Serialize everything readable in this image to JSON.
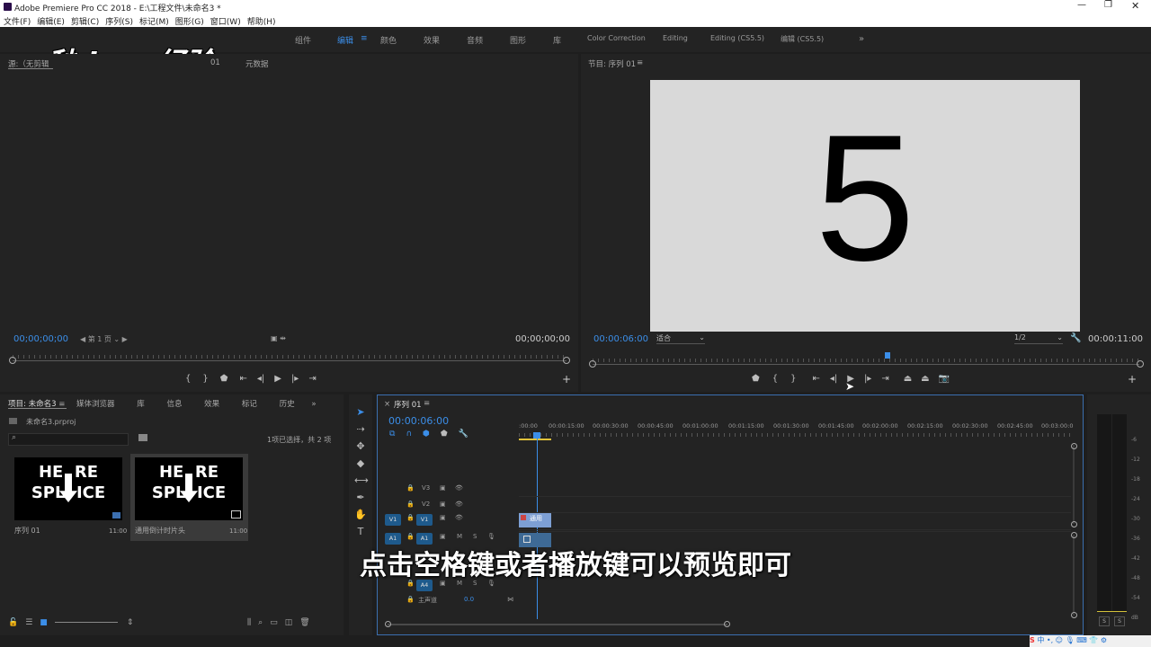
{
  "window": {
    "title": "Adobe Premiere Pro CC 2018 - E:\\工程文件\\未命名3 *"
  },
  "menu": [
    "文件(F)",
    "编辑(E)",
    "剪辑(C)",
    "序列(S)",
    "标记(M)",
    "图形(G)",
    "窗口(W)",
    "帮助(H)"
  ],
  "workspaces": [
    "组件",
    "编辑",
    "颜色",
    "效果",
    "音频",
    "图形",
    "库",
    "Color Correction",
    "Editing",
    "Editing (CS5.5)",
    "编辑 (CS5.5)"
  ],
  "watermark": "秒dong经验",
  "source": {
    "tab": "源:（无剪辑",
    "tab_suffix": "01",
    "meta_tab": "元数据",
    "tc_left": "00;00;00;00",
    "page": "第 1 页",
    "tc_right": "00;00;00;00"
  },
  "program": {
    "tab": "节目: 序列 01",
    "tc_left": "00:00:06:00",
    "fit": "适合",
    "quality": "1/2",
    "tc_right": "00:00:11:00",
    "frame_number": "5"
  },
  "project": {
    "tabs": [
      "项目: 未命名3",
      "媒体浏览器",
      "库",
      "信息",
      "效果",
      "标记",
      "历史"
    ],
    "file": "未命名3.prproj",
    "selection": "1项已选择，共 2 项",
    "items": [
      {
        "name": "序列 01",
        "duration": "11:00"
      },
      {
        "name": "通用倒计时片头",
        "duration": "11:00"
      }
    ],
    "thumb_top": "HE  RE",
    "thumb_bottom": "SPL  ICE"
  },
  "timeline": {
    "tab": "序列 01",
    "tc": "00:00:06:00",
    "ruler": [
      ":00:00",
      "00:00:15:00",
      "00:00:30:00",
      "00:00:45:00",
      "00:01:00:00",
      "00:01:15:00",
      "00:01:30:00",
      "00:01:45:00",
      "00:02:00:00",
      "00:02:15:00",
      "00:02:30:00",
      "00:02:45:00",
      "00:03:00:0"
    ],
    "tracks": {
      "v3": "V3",
      "v2": "V2",
      "v1": "V1",
      "a1": "A1",
      "a4": "A4",
      "master": "主声道",
      "master_val": "0.0",
      "m": "M",
      "s": "S"
    },
    "clip_label": "通用"
  },
  "meter": {
    "db_labels": [
      "-6",
      "-12",
      "-18",
      "-24",
      "-30",
      "-36",
      "-42",
      "-48",
      "-54",
      "dB"
    ],
    "s": "S"
  },
  "subtitle": "点击空格键或者播放键可以预览即可"
}
